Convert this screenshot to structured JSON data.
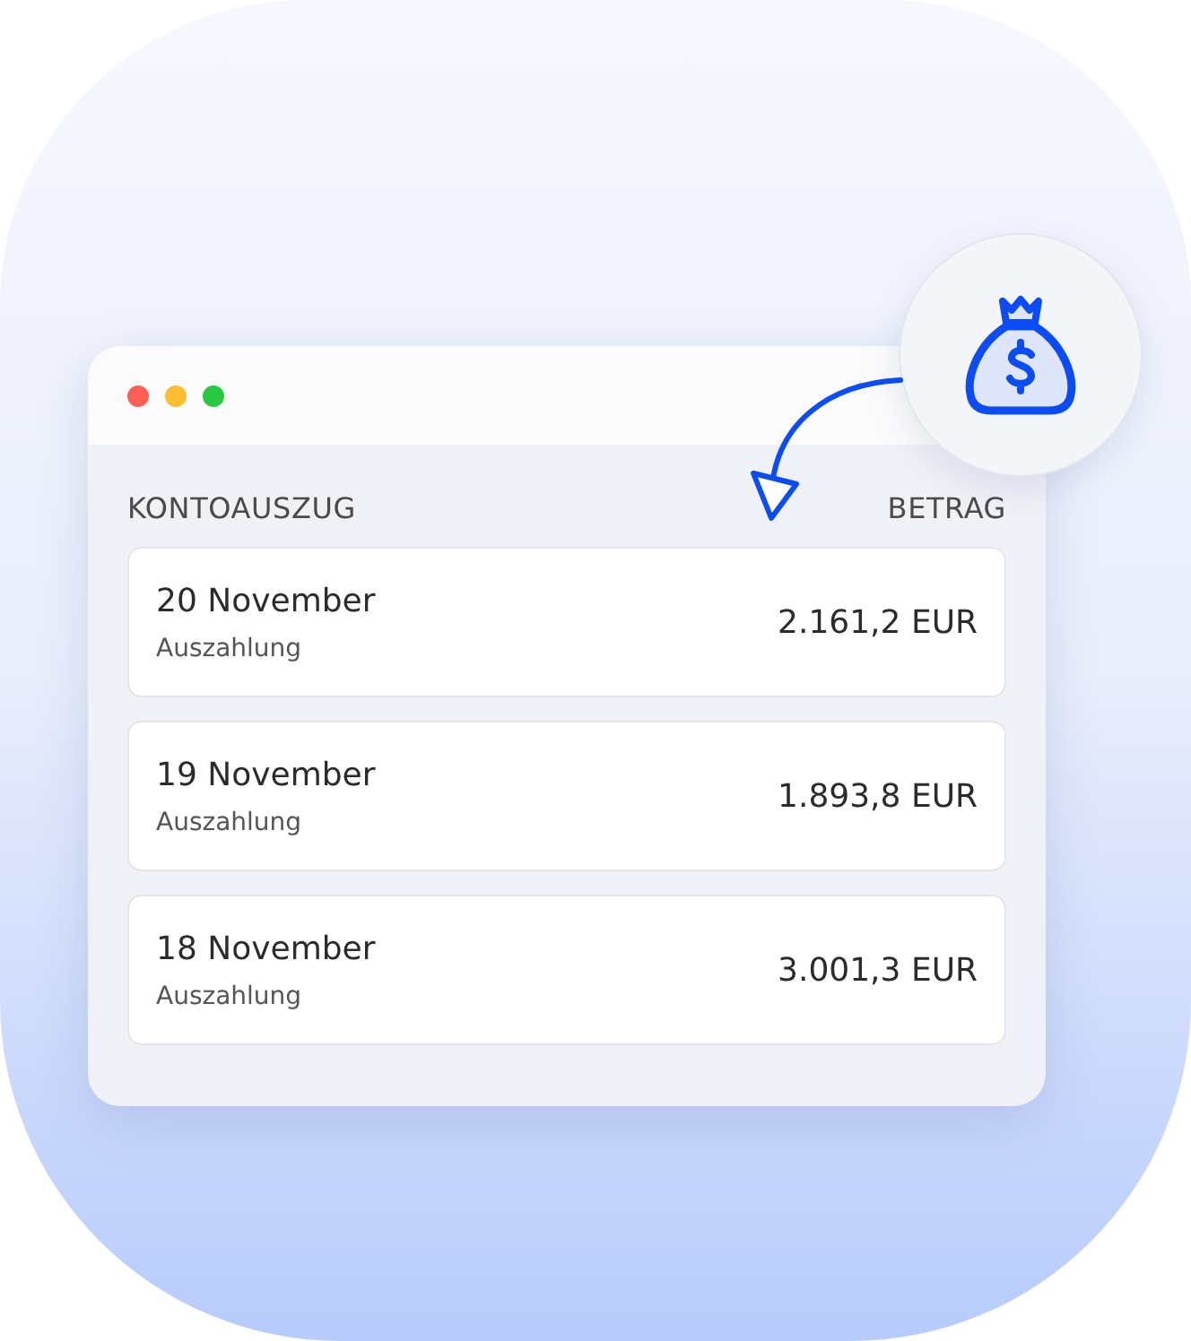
{
  "statement": {
    "heading": "KONTOAUSZUG",
    "amount_heading": "BETRAG",
    "rows": [
      {
        "date": "20 November",
        "type": "Auszahlung",
        "amount": "2.161,2 EUR"
      },
      {
        "date": "19 November",
        "type": "Auszahlung",
        "amount": "1.893,8 EUR"
      },
      {
        "date": "18 November",
        "type": "Auszahlung",
        "amount": "3.001,3 EUR"
      }
    ]
  }
}
